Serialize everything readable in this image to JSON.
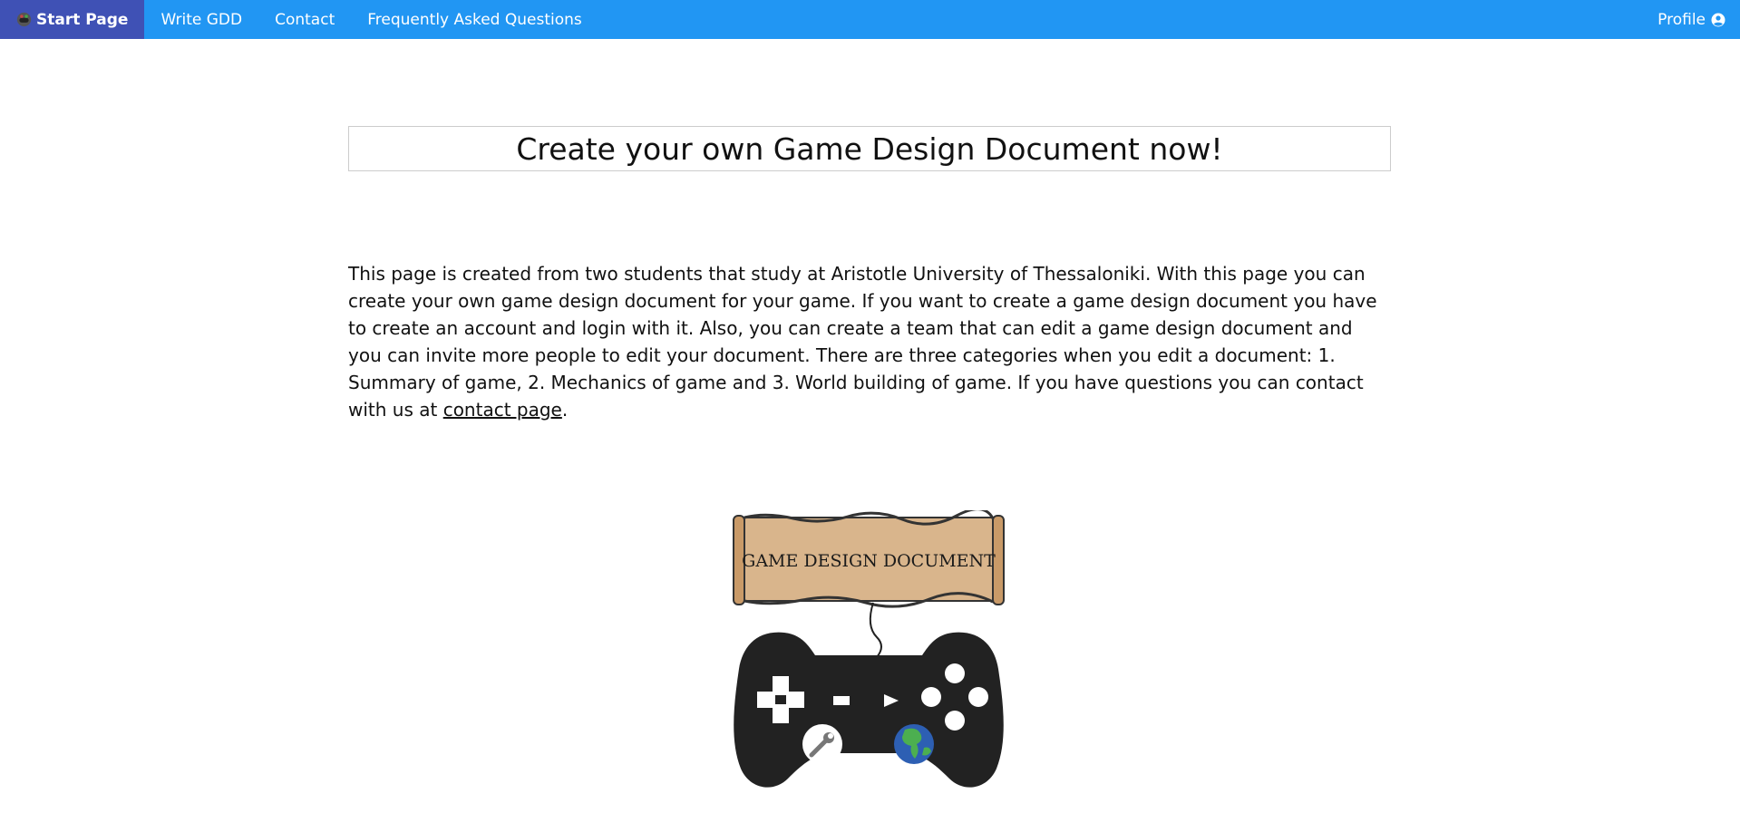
{
  "nav": {
    "brand_label": "Start Page",
    "brand_icon": "controller-logo-icon",
    "items": [
      {
        "label": "Write GDD"
      },
      {
        "label": "Contact"
      },
      {
        "label": "Frequently Asked Questions"
      }
    ],
    "profile_label": "Profile",
    "profile_icon": "user-circle-icon",
    "colors": {
      "bar": "#2196f3",
      "active": "#3f51b5"
    }
  },
  "main": {
    "headline": "Create your own Game Design Document now!",
    "intro_text": "This page is created from two students that study at Aristotle University of Thessaloniki. With this page you can create your own game design document for your game. If you want to create a game design document you have to create an account and login with it. Also, you can create a team that can edit a game design document and you can invite more people to edit your document. There are three categories when you edit a document: 1. Summary of game, 2. Mechanics of game and 3. World building of game. If you have questions you can contact with us at ",
    "contact_link_text": "contact page",
    "intro_suffix": ".",
    "image": {
      "scroll_text": "GAME DESIGN DOCUMENT",
      "icons": [
        "scroll-banner-icon",
        "gamepad-icon",
        "wrench-icon",
        "globe-icon"
      ]
    }
  }
}
